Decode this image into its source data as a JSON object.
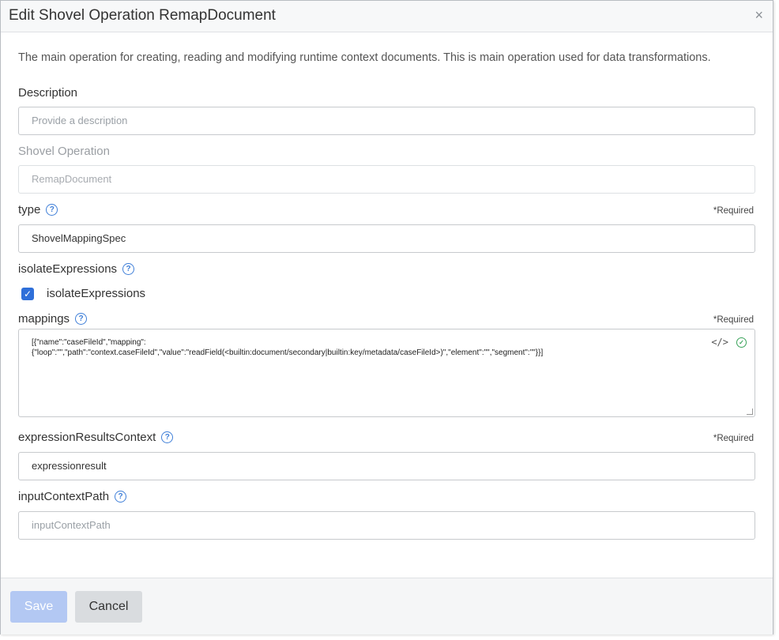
{
  "dialog": {
    "title": "Edit Shovel Operation RemapDocument",
    "close_glyph": "×",
    "intro": "The main operation for creating, reading and modifying runtime context documents. This is main operation used for data transformations."
  },
  "fields": {
    "description": {
      "label": "Description",
      "placeholder": "Provide a description",
      "value": ""
    },
    "shovel_operation": {
      "label": "Shovel Operation",
      "value": "RemapDocument"
    },
    "type": {
      "label": "type",
      "required": "*Required",
      "value": "ShovelMappingSpec"
    },
    "isolate_expressions": {
      "label": "isolateExpressions",
      "checkbox_label": "isolateExpressions",
      "checked": true
    },
    "mappings": {
      "label": "mappings",
      "required": "*Required",
      "value": "[{\"name\":\"caseFileId\",\"mapping\":\n{\"loop\":\"\",\"path\":\"context.caseFileId\",\"value\":\"readField(<builtin:document/secondary|builtin:key/metadata/caseFileId>)\",\"element\":\"\",\"segment\":\"\"}}]",
      "icons": [
        "code-icon",
        "valid-check-icon"
      ]
    },
    "expression_results_context": {
      "label": "expressionResultsContext",
      "required": "*Required",
      "value": "expressionresult"
    },
    "input_context_path": {
      "label": "inputContextPath",
      "placeholder": "inputContextPath",
      "value": ""
    }
  },
  "help_glyph": "?",
  "footer": {
    "save_label": "Save",
    "cancel_label": "Cancel"
  },
  "colors": {
    "accent": "#2f6fd9",
    "save_disabled": "#b3c8f3",
    "valid": "#3aa35a"
  }
}
